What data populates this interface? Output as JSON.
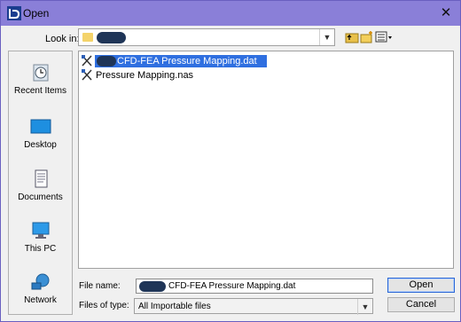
{
  "window": {
    "title": "Open",
    "close_glyph": "✕"
  },
  "lookin": {
    "label": "Look in:",
    "value": ""
  },
  "places": [
    {
      "label": "Recent Items",
      "icon": "recent-items-icon"
    },
    {
      "label": "Desktop",
      "icon": "desktop-icon"
    },
    {
      "label": "Documents",
      "icon": "documents-icon"
    },
    {
      "label": "This PC",
      "icon": "this-pc-icon"
    },
    {
      "label": "Network",
      "icon": "network-icon"
    }
  ],
  "files": [
    {
      "name": "CFD-FEA Pressure Mapping.dat",
      "selected": true
    },
    {
      "name": "Pressure Mapping.nas",
      "selected": false
    }
  ],
  "filename": {
    "label": "File name:",
    "value": "CFD-FEA Pressure Mapping.dat"
  },
  "filetype": {
    "label": "Files of type:",
    "value": "All Importable files"
  },
  "buttons": {
    "open": "Open",
    "cancel": "Cancel"
  },
  "colors": {
    "titlebar": "#8a7fd8",
    "selection": "#2f6fe0",
    "redaction": "#1f3557"
  }
}
